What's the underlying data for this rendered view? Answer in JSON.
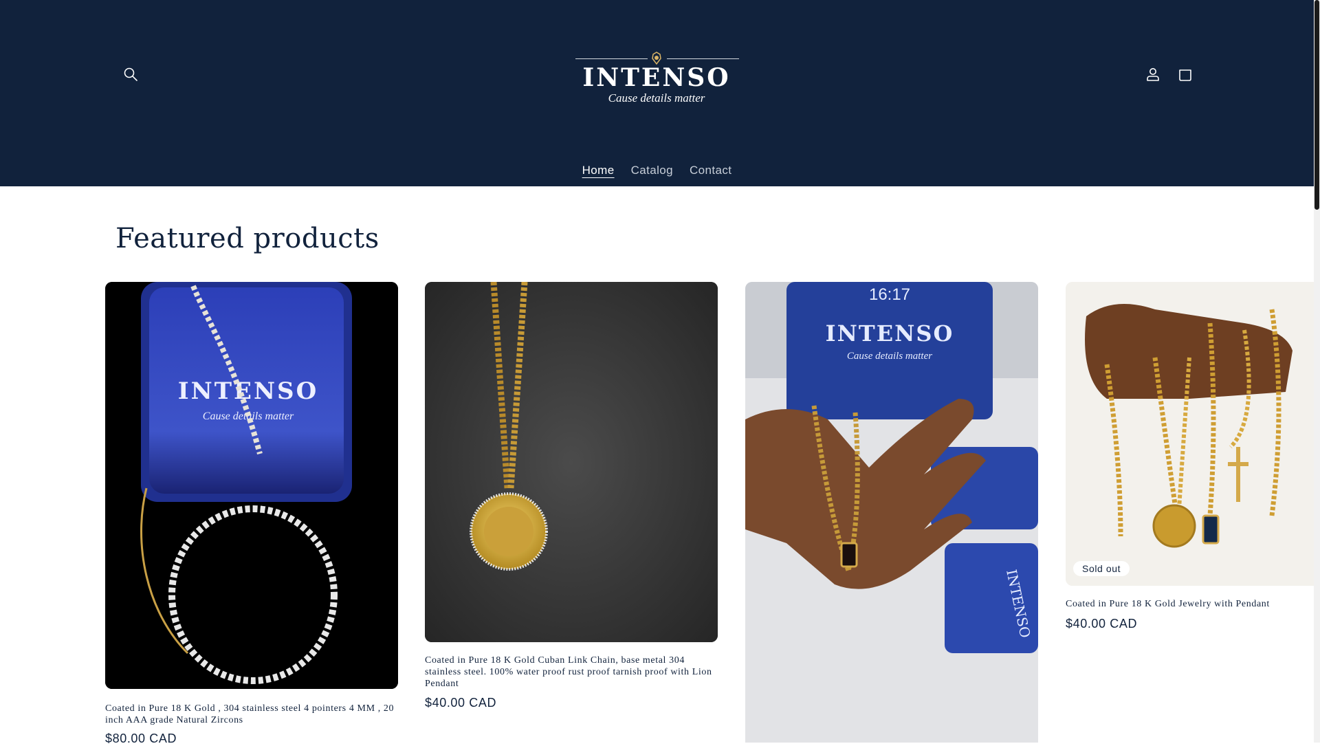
{
  "header": {
    "brand_name": "INTENSO",
    "brand_tagline": "Cause details matter",
    "nav": [
      {
        "label": "Home"
      },
      {
        "label": "Catalog"
      },
      {
        "label": "Contact"
      }
    ],
    "icons": [
      "search-icon",
      "account-icon",
      "cart-icon"
    ],
    "background_color": "#11223c"
  },
  "featured": {
    "title": "Featured products",
    "products": [
      {
        "title": "Coated in Pure 18 K Gold , 304 stainless steel 4 pointers 4 MM , 20 inch AAA grade Natural Zircons",
        "price": "$80.00 CAD"
      },
      {
        "title": "Coated in Pure 18 K Gold Cuban Link Chain, base metal 304 stainless steel. 100% water proof rust proof tarnish proof with Lion Pendant",
        "price": "$40.00 CAD"
      },
      {
        "title": "",
        "price": ""
      },
      {
        "title": "Coated in Pure 18 K Gold Jewelry with Pendant",
        "price": "$40.00 CAD",
        "badge": "Sold out"
      }
    ],
    "photo_texts": {
      "p1_brand": "INTENSO",
      "p1_tag": "Cause details matter",
      "p3_time": "16:17",
      "p3_brand": "INTENSO",
      "p3_tag": "Cause details matter",
      "p3_box": "INTENSO"
    }
  }
}
